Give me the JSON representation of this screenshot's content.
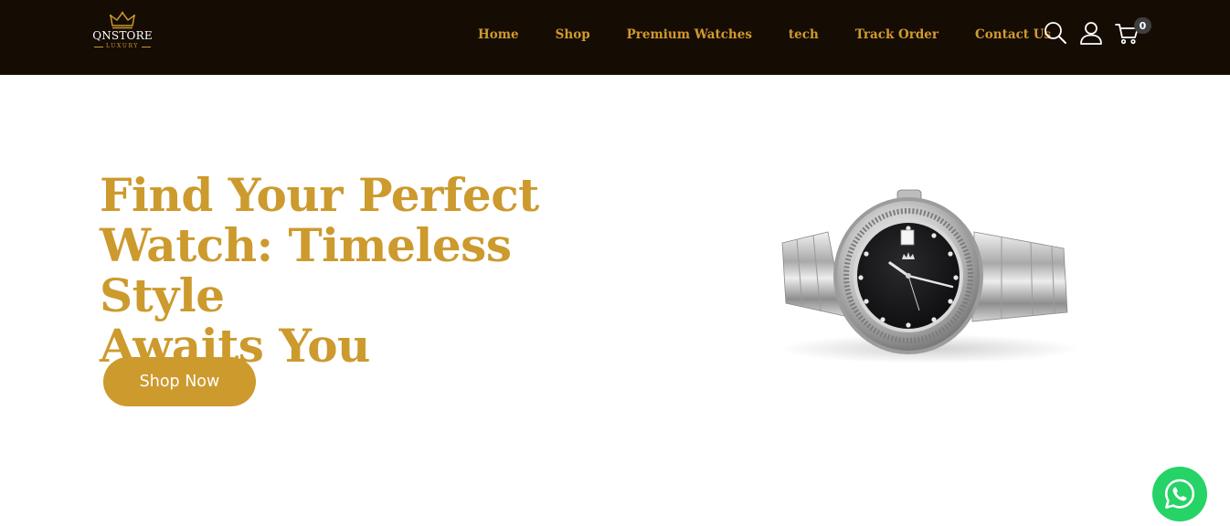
{
  "header": {
    "logo": {
      "brand": "QNSTORE",
      "tagline": "LUXURY",
      "icon": "crown-icon"
    },
    "nav": [
      {
        "label": "Home"
      },
      {
        "label": "Shop"
      },
      {
        "label": "Premium Watches"
      },
      {
        "label": "tech"
      },
      {
        "label": "Track Order"
      },
      {
        "label": "Contact Us"
      }
    ],
    "icons": {
      "search": "search-icon",
      "account": "user-icon",
      "cart": "cart-icon"
    },
    "cart_count": "0"
  },
  "hero": {
    "title_lines": [
      "Find Your Perfect",
      "Watch: Timeless Style",
      "Awaits You"
    ],
    "cta_label": "Shop Now"
  },
  "floating": {
    "whatsapp_icon": "whatsapp-icon"
  },
  "colors": {
    "header_bg": "#150c04",
    "accent_gold": "#cc9a2d",
    "whatsapp_green": "#25d366",
    "badge_bg": "#3f3f3f"
  }
}
